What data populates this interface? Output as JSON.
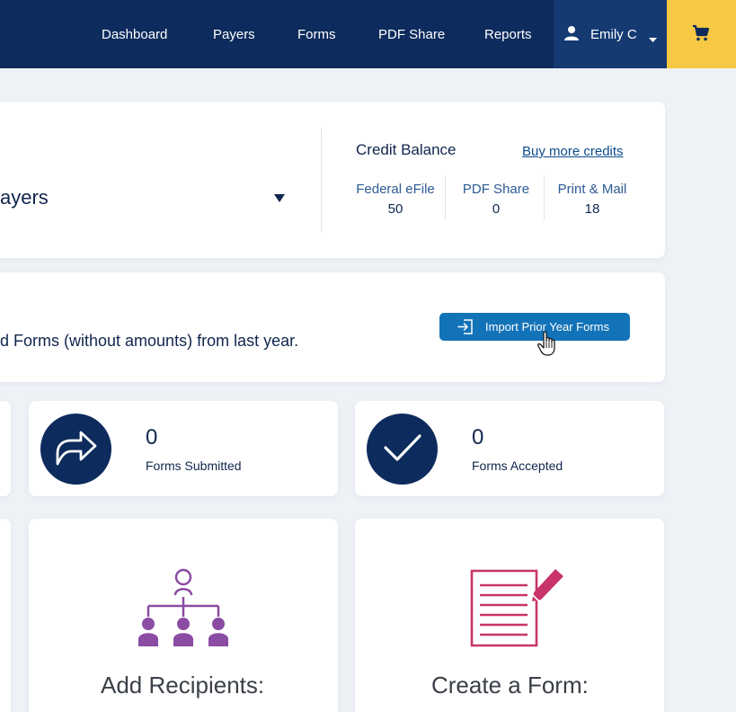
{
  "nav": {
    "items": [
      "Dashboard",
      "Payers",
      "Forms",
      "PDF Share",
      "Reports"
    ],
    "user_name": "Emily C",
    "user_icon": "person-icon",
    "cart_icon": "cart-icon",
    "colors": {
      "nav_bg": "#0d2b5c",
      "user_bg": "#153a72",
      "cart_bg": "#f7c843"
    }
  },
  "payer_card": {
    "selected_payer": "ayers"
  },
  "credits": {
    "title": "Credit Balance",
    "buy_link": "Buy more credits",
    "columns": [
      {
        "label": "Federal eFile",
        "value": "50"
      },
      {
        "label": "PDF Share",
        "value": "0"
      },
      {
        "label": "Print & Mail",
        "value": "18"
      }
    ]
  },
  "import": {
    "text": "d Forms (without amounts) from last year.",
    "button_label": "Import Prior Year Forms",
    "button_color": "#1373b8"
  },
  "stats": [
    {
      "value": "0",
      "label": "Forms Submitted",
      "icon": "forward-arrow-icon"
    },
    {
      "value": "0",
      "label": "Forms Accepted",
      "icon": "checkmark-icon"
    }
  ],
  "actions": [
    {
      "title": "Add Recipients:",
      "icon": "org-chart-icon",
      "color": "#8b4ca3"
    },
    {
      "title": "Create a Form:",
      "icon": "document-edit-icon",
      "color": "#c8336b"
    }
  ]
}
